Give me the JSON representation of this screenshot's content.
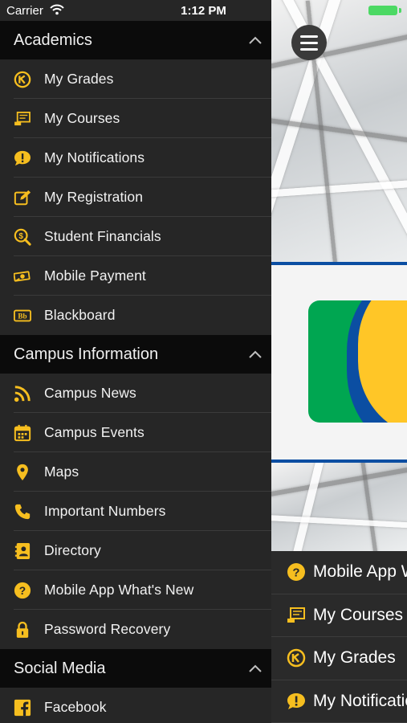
{
  "status_bar": {
    "carrier": "Carrier",
    "time": "1:12 PM",
    "battery_color": "#4cd964"
  },
  "theme": {
    "accent": "#f6be1f",
    "drawer_bg": "#262626",
    "header_bg": "#0b0b0b",
    "brand_blue": "#0b4ea2",
    "brand_green": "#00a651",
    "brand_gold": "#ffc627"
  },
  "drawer": {
    "sections": [
      {
        "title": "Academics",
        "items": [
          {
            "label": "My Grades",
            "icon": "grades-icon"
          },
          {
            "label": "My Courses",
            "icon": "courses-icon"
          },
          {
            "label": "My Notifications",
            "icon": "notifications-icon"
          },
          {
            "label": "My Registration",
            "icon": "registration-icon"
          },
          {
            "label": "Student Financials",
            "icon": "financials-icon"
          },
          {
            "label": "Mobile Payment",
            "icon": "payment-icon"
          },
          {
            "label": "Blackboard",
            "icon": "blackboard-icon"
          }
        ]
      },
      {
        "title": "Campus Information",
        "items": [
          {
            "label": "Campus News",
            "icon": "rss-icon"
          },
          {
            "label": "Campus Events",
            "icon": "calendar-icon"
          },
          {
            "label": "Maps",
            "icon": "map-pin-icon"
          },
          {
            "label": "Important Numbers",
            "icon": "phone-icon"
          },
          {
            "label": "Directory",
            "icon": "directory-icon"
          },
          {
            "label": "Mobile App What's New",
            "icon": "question-icon"
          },
          {
            "label": "Password Recovery",
            "icon": "lock-icon"
          }
        ]
      },
      {
        "title": "Social Media",
        "items": [
          {
            "label": "Facebook",
            "icon": "facebook-icon"
          }
        ]
      }
    ]
  },
  "main": {
    "quick_links": [
      {
        "label": "Mobile App What's New",
        "icon": "question-icon"
      },
      {
        "label": "My Courses",
        "icon": "courses-icon"
      },
      {
        "label": "My Grades",
        "icon": "grades-icon"
      },
      {
        "label": "My Notifications",
        "icon": "notifications-icon"
      }
    ]
  }
}
